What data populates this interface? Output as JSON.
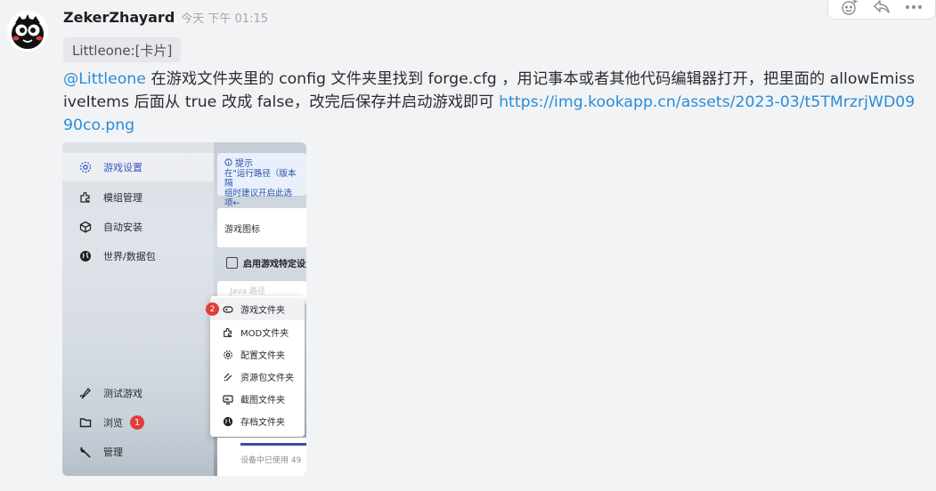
{
  "message": {
    "author": "ZekerZhayard",
    "timestamp": "今天 下午 01:15",
    "quote": "Littleone:[卡片]",
    "mention": "@Littleone",
    "text": " 在游戏文件夹里的 config 文件夹里找到 forge.cfg ，用记事本或者其他代码编辑器打开，把里面的 allowEmissiveItems 后面从 true 改成 false，改完后保存并启动游戏即可 ",
    "link": "https://img.kookapp.cn/assets/2023-03/t5TMrzrjWD0990co.png"
  },
  "toolbar": {
    "icons": [
      "add-reaction-icon",
      "reply-icon",
      "more-icon"
    ]
  },
  "attachment": {
    "nav": {
      "items": [
        {
          "label": "游戏设置",
          "icon": "gear-icon",
          "active": true
        },
        {
          "label": "模组管理",
          "icon": "puzzle-icon"
        },
        {
          "label": "自动安装",
          "icon": "cube-icon"
        },
        {
          "label": "世界/数据包",
          "icon": "globe-icon"
        }
      ],
      "bottom": [
        {
          "label": "测试游戏",
          "icon": "rocket-icon"
        },
        {
          "label": "浏览",
          "icon": "folder-icon",
          "badge": "1"
        },
        {
          "label": "管理",
          "icon": "wrench-icon"
        }
      ]
    },
    "tip": {
      "title": "提示",
      "line1": "在\"运行路径（版本隔",
      "line2": "组时建议开启此选项←"
    },
    "game_icon_label": "游戏图标",
    "checkbox_label": "启用游戏特定设置",
    "java_placeholder": "Java 路径",
    "menu": {
      "badge": "2",
      "items": [
        {
          "label": "游戏文件夹",
          "icon": "gamepad-icon"
        },
        {
          "label": "MOD文件夹",
          "icon": "puzzle-icon"
        },
        {
          "label": "配置文件夹",
          "icon": "gear-icon"
        },
        {
          "label": "资源包文件夹",
          "icon": "texture-icon"
        },
        {
          "label": "截图文件夹",
          "icon": "screenshot-icon"
        },
        {
          "label": "存档文件夹",
          "icon": "globe-icon"
        }
      ]
    },
    "storage_text": "设备中已使用 49",
    "storage_progress": 1.0
  },
  "colors": {
    "link": "#2a8cd9",
    "badge": "#e33b3b",
    "active_nav": "#3a58c8"
  }
}
